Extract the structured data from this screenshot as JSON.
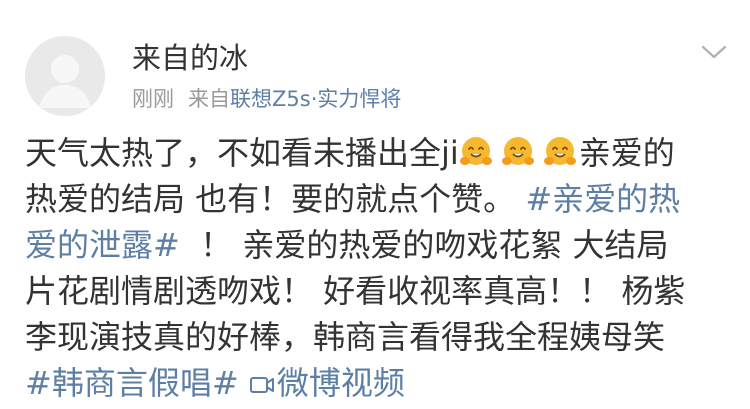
{
  "post": {
    "username": "来自的冰",
    "timestamp": "刚刚",
    "source_prefix": "来自",
    "source_device": "联想Z5s·实力悍将",
    "chevron_icon": "chevron-down-icon",
    "lines": {
      "l1_text": "天气太热了，不如看未播出全ji",
      "l1_tail": "亲爱的",
      "l2_text": "热爱的结局  也有！要的就点个赞。",
      "l2_topic": "#亲爱的热",
      "l3_topic": "爱的泄露#",
      "l3_text": "  ！ 亲爱的热爱的吻戏花絮 大结局",
      "l4_text": "片花剧情剧透吻戏！ 好看收视率真高！！ 杨紫",
      "l5_text": "李现演技真的好棒，韩商言看得我全程姨母笑",
      "l6_topic": "#韩商言假唱#",
      "l6_video": "微博视频"
    },
    "emoji_name": "hug-emoji",
    "emoji_count": 3,
    "colors": {
      "link": "#5d7fa6",
      "text": "#333333",
      "meta": "#9a9a9a",
      "emoji": "#f5b82e"
    }
  }
}
